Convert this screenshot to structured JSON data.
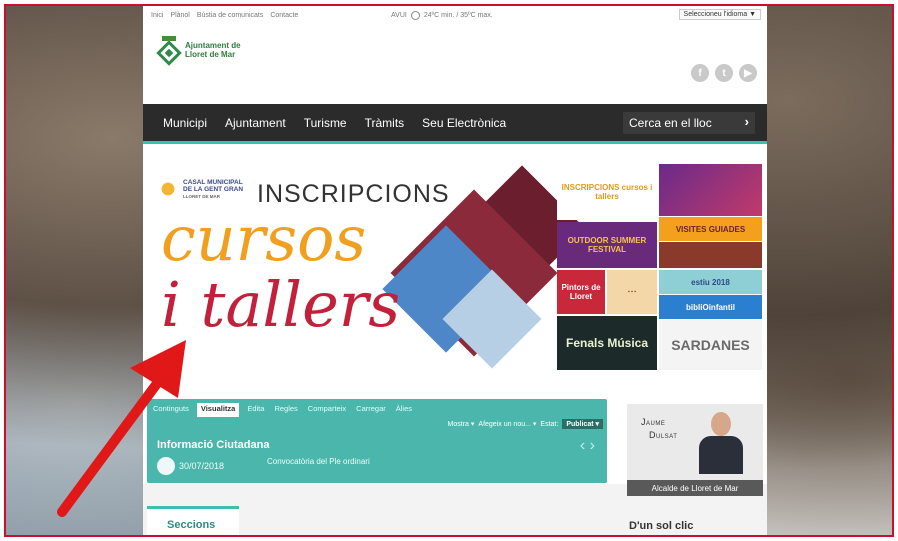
{
  "util": {
    "links": [
      "Inici",
      "Plànol",
      "Bústia de comunicats",
      "Contacte"
    ],
    "weather": "AVUI",
    "temps": "24ºC min. / 35ºC max.",
    "language": "Seleccioneu l'idioma ▼"
  },
  "logo": {
    "line1": "Ajuntament de",
    "line2": "Lloret de Mar"
  },
  "social": {
    "facebook": "f",
    "twitter": "t",
    "youtube": "▶"
  },
  "nav": {
    "items": [
      "Municipi",
      "Ajuntament",
      "Turisme",
      "Tràmits",
      "Seu Electrònica"
    ],
    "search_placeholder": "Cerca en el lloc",
    "search_arrow": "›"
  },
  "banner": {
    "casal": {
      "l1": "CASAL MUNICIPAL",
      "l2": "DE LA GENT GRAN",
      "l3": "LLORET DE MAR"
    },
    "inscripcions": "INSCRIPCIONS",
    "cursos": "cursos",
    "tallers": "i tallers",
    "tiles": {
      "t1": "INSCRIPCIONS cursos i tallers",
      "t2": "VISITES GUIADES",
      "t3": "OUTDOOR SUMMER FESTIVAL",
      "t4": "Pintors de Lloret",
      "t5": "estiu 2018",
      "t6": "bibliOinfantil",
      "t7": "Fenals Música",
      "t8": "SARDANES"
    }
  },
  "cms": {
    "tabs": [
      "Continguts",
      "Visualitza",
      "Edita",
      "Regles",
      "Comparteix",
      "Carregar",
      "Àlies"
    ],
    "mostra": "Mostra ▾",
    "afegeix": "Afegeix un nou... ▾",
    "estat": "Estat:",
    "publicat": "Publicat ▾",
    "info_title": "Informació Ciutadana",
    "date": "30/07/2018",
    "item": "Convocatòria del Ple ordinari",
    "arrows": "‹  ›"
  },
  "mayor": {
    "first": "Jaume",
    "last": "Dulsat",
    "caption": "Alcalde de Lloret de Mar"
  },
  "sections": {
    "seccions": "Seccions",
    "dun_sol_clic": "D'un sol clic"
  },
  "colors": {
    "accent": "#3dbfb0",
    "nav": "#2b2b2b",
    "frame": "#c8102e"
  }
}
